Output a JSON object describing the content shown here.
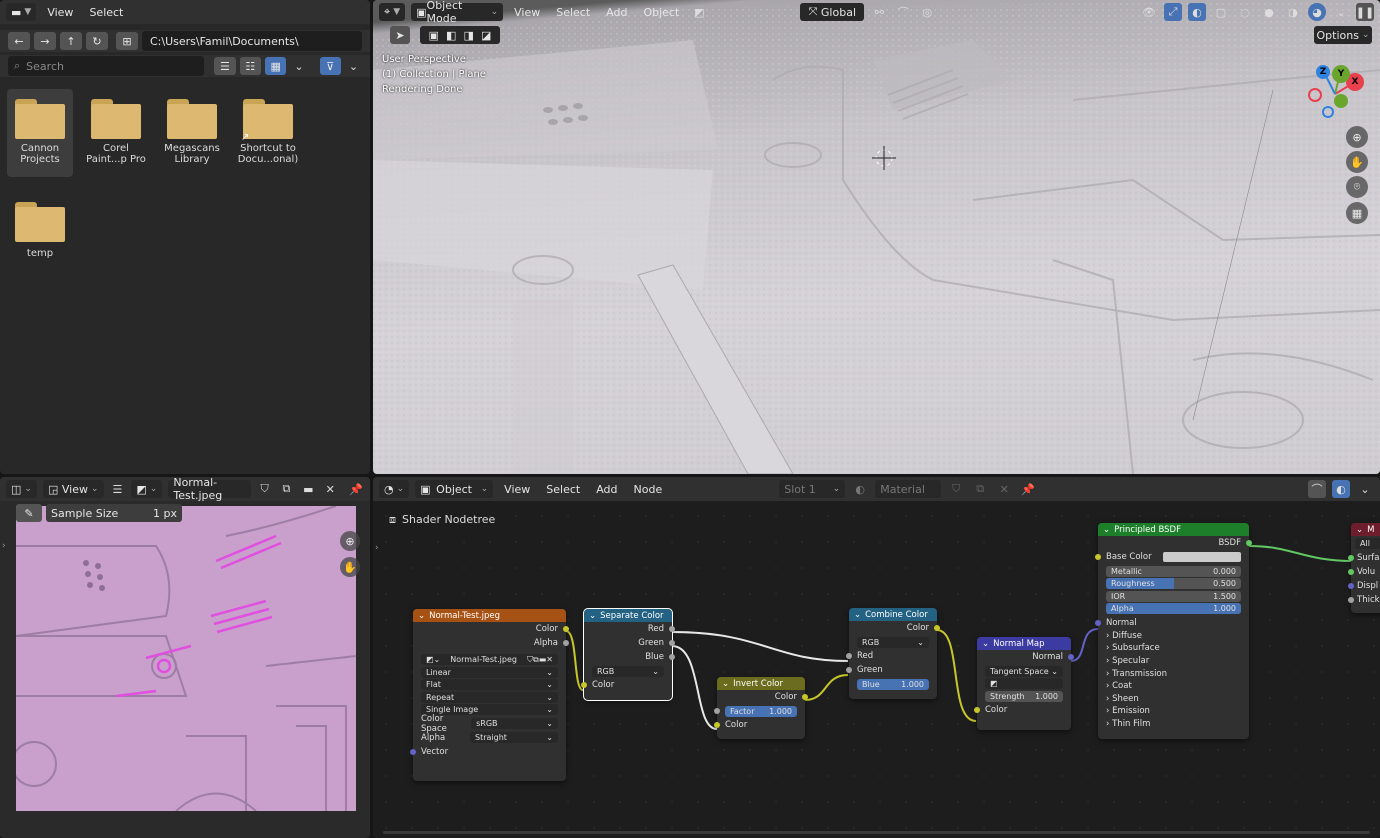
{
  "file_browser": {
    "menu": [
      "View",
      "Select"
    ],
    "path": "C:\\Users\\Famil\\Documents\\",
    "search_placeholder": "Search",
    "items": [
      {
        "label": "Cannon Projects",
        "line1": "Cannon",
        "line2": "Projects",
        "selected": true
      },
      {
        "label": "Corel Paint...p Pro",
        "line1": "Corel",
        "line2": "Paint...p Pro"
      },
      {
        "label": "Megascans Library",
        "line1": "Megascans",
        "line2": "Library"
      },
      {
        "label": "Shortcut to Docu...onal)",
        "line1": "Shortcut to",
        "line2": "Docu...onal)",
        "shortcut": true
      },
      {
        "label": "temp",
        "line1": "temp",
        "line2": ""
      }
    ]
  },
  "viewport": {
    "mode": "Object Mode",
    "menu": [
      "View",
      "Select",
      "Add",
      "Object"
    ],
    "transform_orientation": "Global",
    "options_label": "Options",
    "overlay_lines": [
      "User Perspective",
      "(1) Collection | Plane",
      "Rendering Done"
    ],
    "gizmo_axes": {
      "x": "X",
      "y": "Y",
      "z": "Z"
    },
    "colors": {
      "x": "#e8414d",
      "y": "#6aa62e",
      "z": "#2f83e0"
    }
  },
  "image_editor": {
    "view_label": "View",
    "image_name": "Normal-Test.jpeg",
    "sample_size_label": "Sample Size",
    "sample_size_value": "1 px"
  },
  "node_editor": {
    "context": "Object",
    "menu": [
      "View",
      "Select",
      "Add",
      "Node"
    ],
    "slot": "Slot 1",
    "material_placeholder": "Material",
    "breadcrumb": "Shader Nodetree",
    "nodes": {
      "image": {
        "title": "Normal-Test.jpeg",
        "out_color": "Color",
        "out_alpha": "Alpha",
        "image_name": "Normal-Test.jpeg",
        "interpolation": "Linear",
        "projection": "Flat",
        "extension": "Repeat",
        "source": "Single Image",
        "color_space_label": "Color Space",
        "color_space": "sRGB",
        "alpha_label": "Alpha",
        "alpha_mode": "Straight",
        "in_vector": "Vector"
      },
      "separate": {
        "title": "Separate Color",
        "out_red": "Red",
        "out_green": "Green",
        "out_blue": "Blue",
        "mode": "RGB",
        "in_color": "Color"
      },
      "invert": {
        "title": "Invert Color",
        "out_color": "Color",
        "factor_label": "Factor",
        "factor_value": "1.000",
        "in_color": "Color"
      },
      "combine": {
        "title": "Combine Color",
        "out_color": "Color",
        "mode": "RGB",
        "in_red": "Red",
        "in_green": "Green",
        "blue_label": "Blue",
        "blue_value": "1.000"
      },
      "normal_map": {
        "title": "Normal Map",
        "out_normal": "Normal",
        "space": "Tangent Space",
        "strength_label": "Strength",
        "strength_value": "1.000",
        "in_color": "Color"
      },
      "bsdf": {
        "title": "Principled BSDF",
        "out": "BSDF",
        "base_color_label": "Base Color",
        "metallic_label": "Metallic",
        "metallic_value": "0.000",
        "roughness_label": "Roughness",
        "roughness_value": "0.500",
        "ior_label": "IOR",
        "ior_value": "1.500",
        "alpha_label": "Alpha",
        "alpha_value": "1.000",
        "normal_label": "Normal",
        "panels": [
          "Diffuse",
          "Subsurface",
          "Specular",
          "Transmission",
          "Coat",
          "Sheen",
          "Emission",
          "Thin Film"
        ]
      },
      "output": {
        "title": "M",
        "target": "All",
        "inputs": [
          "Surfa",
          "Volu",
          "Displ",
          "Thick"
        ]
      }
    },
    "colors": {
      "image_header": "#a65215",
      "separate_header": "#246283",
      "invert_header": "#6c6c1f",
      "combine_header": "#246283",
      "normal_map_header": "#3b3ba2",
      "bsdf_header": "#1d7f2a",
      "output_header": "#6e1d2c"
    }
  }
}
